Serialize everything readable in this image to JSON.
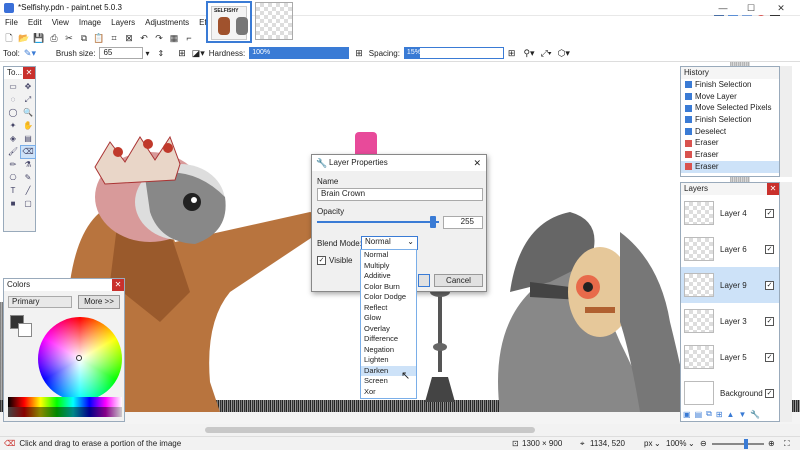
{
  "window": {
    "title": "*Selfishy.pdn - paint.net 5.0.3",
    "min": "—",
    "max": "☐",
    "close": "✕"
  },
  "menu": [
    "File",
    "Edit",
    "View",
    "Image",
    "Layers",
    "Adjustments",
    "Effects"
  ],
  "tabs": [
    {
      "label": "SELFISHY"
    }
  ],
  "toolbar": {
    "tool_label": "Tool:",
    "brush_size_label": "Brush size:",
    "brush_size_value": "65",
    "hardness_label": "Hardness:",
    "hardness_value": "100%",
    "hardness_level": 100,
    "spacing_label": "Spacing:",
    "spacing_value": "15%",
    "spacing_level": 15
  },
  "tools_panel": {
    "title": "To..."
  },
  "colors_panel": {
    "title": "Colors",
    "mode": "Primary",
    "more": "More >>"
  },
  "history": {
    "title": "History",
    "items": [
      {
        "label": "Finish Selection",
        "icon": "selection-icon",
        "color": "#3a7bd5"
      },
      {
        "label": "Move Layer",
        "icon": "move-icon",
        "color": "#3a7bd5"
      },
      {
        "label": "Move Selected Pixels",
        "icon": "move-icon",
        "color": "#3a7bd5"
      },
      {
        "label": "Finish Selection",
        "icon": "selection-icon",
        "color": "#3a7bd5"
      },
      {
        "label": "Deselect",
        "icon": "deselect-icon",
        "color": "#3a7bd5"
      },
      {
        "label": "Eraser",
        "icon": "eraser-icon",
        "color": "#d9534f"
      },
      {
        "label": "Eraser",
        "icon": "eraser-icon",
        "color": "#d9534f"
      },
      {
        "label": "Eraser",
        "icon": "eraser-icon",
        "color": "#d9534f",
        "selected": true
      }
    ]
  },
  "layers": {
    "title": "Layers",
    "items": [
      {
        "name": "Layer 4",
        "visible": true,
        "selected": false
      },
      {
        "name": "Layer 6",
        "visible": true,
        "selected": false
      },
      {
        "name": "Layer 9",
        "visible": true,
        "selected": true
      },
      {
        "name": "Layer 3",
        "visible": true,
        "selected": false
      },
      {
        "name": "Layer 5",
        "visible": true,
        "selected": false
      },
      {
        "name": "Background",
        "visible": true,
        "selected": false
      }
    ]
  },
  "dialog": {
    "title": "Layer Properties",
    "name_label": "Name",
    "name_value": "Brain Crown",
    "opacity_label": "Opacity",
    "opacity_value": "255",
    "blend_label": "Blend Mode:",
    "blend_value": "Normal",
    "visible_label": "Visible",
    "cancel": "Cancel",
    "blend_options": [
      "Normal",
      "Multiply",
      "Additive",
      "Color Burn",
      "Color Dodge",
      "Reflect",
      "Glow",
      "Overlay",
      "Difference",
      "Negation",
      "Lighten",
      "Darken",
      "Screen",
      "Xor"
    ],
    "highlighted": "Darken"
  },
  "status": {
    "hint": "Click and drag to erase a portion of the image",
    "image_size": "1300 × 900",
    "cursor": "1134, 520",
    "units": "px",
    "zoom": "100%"
  },
  "colors": {
    "accent": "#3a7bd5",
    "close": "#c9302c",
    "selection": "#cde2f8"
  }
}
